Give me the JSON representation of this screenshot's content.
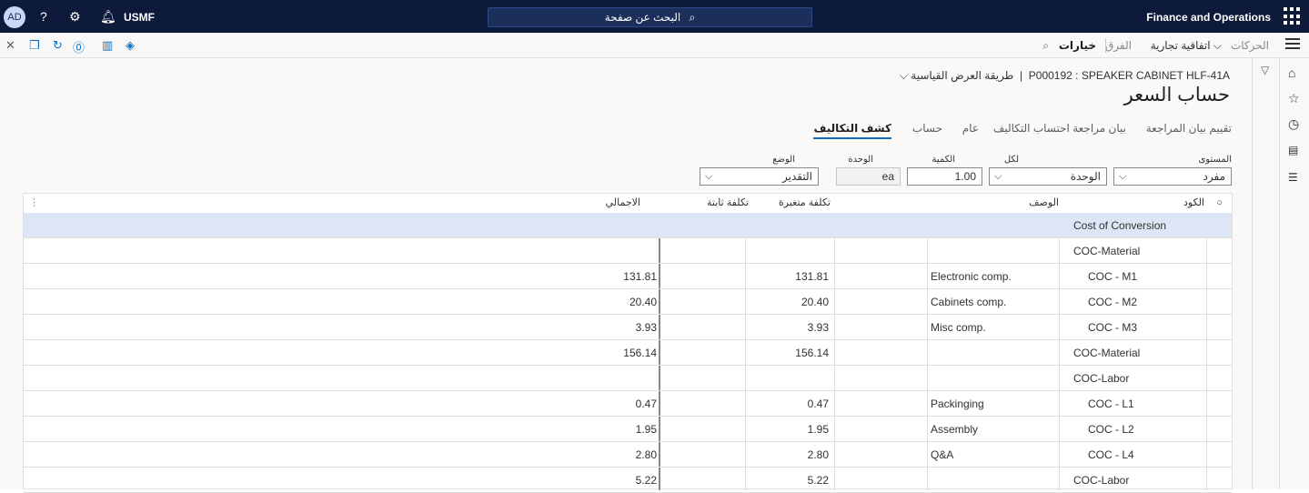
{
  "topbar": {
    "app_title": "Finance and Operations",
    "search_placeholder": "البحث عن صفحة",
    "company": "USMF",
    "avatar_initials": "AD"
  },
  "actionbar": {
    "items": [
      "الحركات",
      "اتفاقية تجارية",
      "الفرق",
      "خيارات"
    ]
  },
  "page": {
    "breadcrumb": "P000192 : SPEAKER CABINET HLF-41A",
    "view_selector": "طريقة العرض القياسية",
    "title": "حساب السعر"
  },
  "tabs": [
    "تقييم بيان المراجعة",
    "بيان مراجعة احتساب التكاليف",
    "عام",
    "حساب",
    "كشف التكاليف"
  ],
  "filters": {
    "level_label": "المستوى",
    "level_value": "مفرد",
    "per_label": "لكل",
    "per_value": "الوحدة",
    "qty_label": "الكمية",
    "qty_value": "1.00",
    "unit_label": "الوحدة",
    "unit_value": "ea",
    "status_label": "الوضع",
    "status_value": "التقدير"
  },
  "grid": {
    "headers": {
      "code": "الكود",
      "description": "الوصف",
      "variable_cost": "تكلفة متغيرة",
      "fixed_cost": "تكلفة ثابتة",
      "total": "الاجمالي"
    },
    "rows": [
      {
        "code": "Cost of Conversion",
        "description": "",
        "variable": "",
        "fixed": "",
        "total": ""
      },
      {
        "code": "COC-Material",
        "description": "",
        "variable": "",
        "fixed": "",
        "total": ""
      },
      {
        "code": "COC - M1",
        "description": "Electronic comp.",
        "variable": "131.81",
        "fixed": "",
        "total": "131.81"
      },
      {
        "code": "COC - M2",
        "description": "Cabinets comp.",
        "variable": "20.40",
        "fixed": "",
        "total": "20.40"
      },
      {
        "code": "COC - M3",
        "description": "Misc comp.",
        "variable": "3.93",
        "fixed": "",
        "total": "3.93"
      },
      {
        "code": "COC-Material",
        "description": "",
        "variable": "156.14",
        "fixed": "",
        "total": "156.14"
      },
      {
        "code": "COC-Labor",
        "description": "",
        "variable": "",
        "fixed": "",
        "total": ""
      },
      {
        "code": "COC - L1",
        "description": "Packinging",
        "variable": "0.47",
        "fixed": "",
        "total": "0.47"
      },
      {
        "code": "COC - L2",
        "description": "Assembly",
        "variable": "1.95",
        "fixed": "",
        "total": "1.95"
      },
      {
        "code": "COC - L4",
        "description": "Q&A",
        "variable": "2.80",
        "fixed": "",
        "total": "2.80"
      },
      {
        "code": "COC-Labor",
        "description": "",
        "variable": "5.22",
        "fixed": "",
        "total": "5.22"
      }
    ]
  }
}
